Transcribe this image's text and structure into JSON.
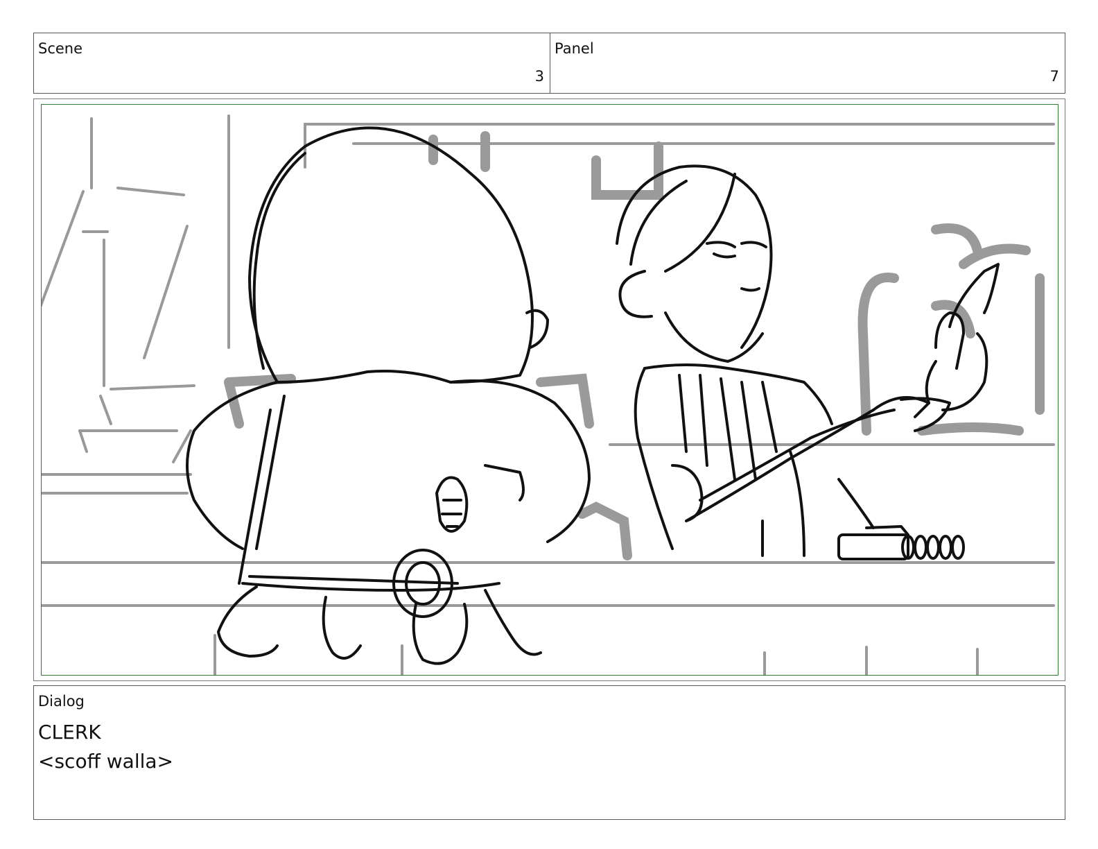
{
  "header": {
    "scene_label": "Scene",
    "scene_number": "3",
    "panel_label": "Panel",
    "panel_number": "7"
  },
  "artwork": {
    "description_icon": "storyboard-sketch-icon",
    "frame_color": "#2f7a2f"
  },
  "dialog": {
    "label": "Dialog",
    "character": "CLERK",
    "line": "<scoff walla>"
  }
}
